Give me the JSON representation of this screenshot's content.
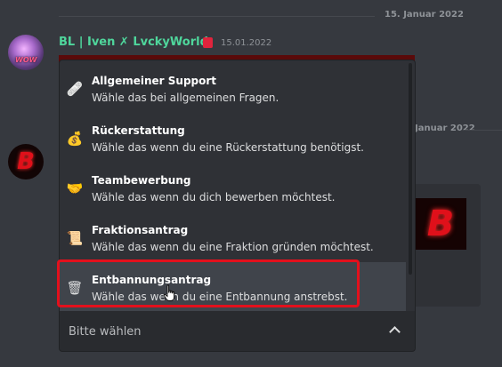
{
  "chat": {
    "date_top": "15. Januar 2022",
    "date_second_partial": "Januar 2022",
    "message": {
      "username": "BL | Iven ✗ LvckyWorld",
      "timestamp": "15.01.2022",
      "avatar_text": "WOW"
    },
    "bot_avatar_letter": "B",
    "embed_letter": "B"
  },
  "dropdown": {
    "options": [
      {
        "label": "Allgemeiner Support",
        "description": "Wähle das bei allgemeinen Fragen.",
        "icon": "bandage-icon",
        "glyph": "🩹"
      },
      {
        "label": "Rückerstattung",
        "description": "Wähle das wenn du eine Rückerstattung benötigst.",
        "icon": "money-bag-icon",
        "glyph": "💰"
      },
      {
        "label": "Teambewerbung",
        "description": "Wähle das wenn du dich bewerben möchtest.",
        "icon": "handshake-icon",
        "glyph": "🤝"
      },
      {
        "label": "Fraktionsantrag",
        "description": "Wähle das wenn du eine Fraktion gründen möchtest.",
        "icon": "scroll-icon",
        "glyph": "📜"
      },
      {
        "label": "Entbannungsantrag",
        "description": "Wähle das wenn du eine Entbannung anstrebst.",
        "icon": "trash-can-icon",
        "glyph": "🗑"
      }
    ],
    "hovered_index": 4,
    "placeholder": "Bitte wählen"
  },
  "colors": {
    "background": "#36393f",
    "dropdown_bg": "#2f3136",
    "hover_bg": "#40444b",
    "username": "#4fd69c",
    "highlight": "#e3101c"
  }
}
